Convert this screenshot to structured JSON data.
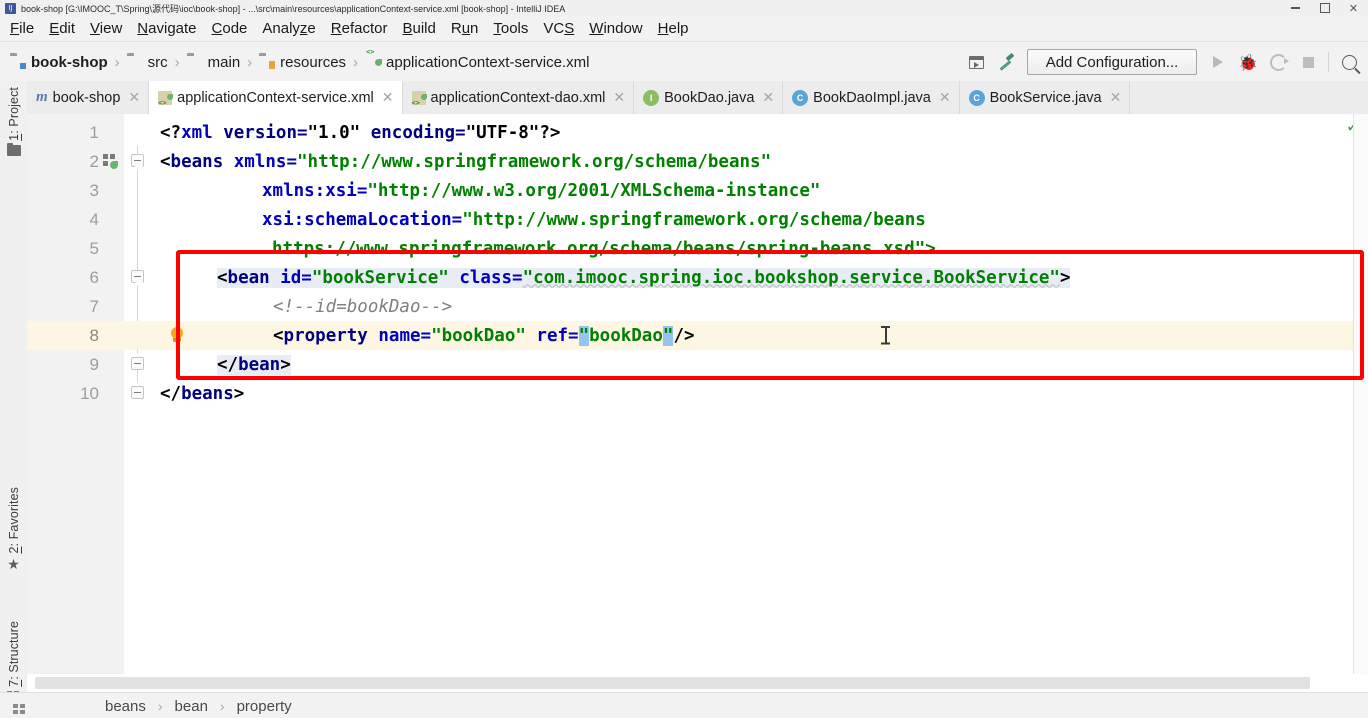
{
  "window": {
    "title": "book-shop [G:\\IMOOC_T\\Spring\\源代码\\ioc\\book-shop] - ...\\src\\main\\resources\\applicationContext-service.xml [book-shop] - IntelliJ IDEA",
    "app_icon": "intellij-idea-icon",
    "controls": {
      "minimize": "minimize-icon",
      "maximize": "restore-icon",
      "close": "close-icon"
    }
  },
  "menubar": {
    "items": [
      {
        "label": "File",
        "mnemonic": "F"
      },
      {
        "label": "Edit",
        "mnemonic": "E"
      },
      {
        "label": "View",
        "mnemonic": "V"
      },
      {
        "label": "Navigate",
        "mnemonic": "N"
      },
      {
        "label": "Code",
        "mnemonic": "C"
      },
      {
        "label": "Analyze",
        "mnemonic": "z"
      },
      {
        "label": "Refactor",
        "mnemonic": "R"
      },
      {
        "label": "Build",
        "mnemonic": "B"
      },
      {
        "label": "Run",
        "mnemonic": "u"
      },
      {
        "label": "Tools",
        "mnemonic": "T"
      },
      {
        "label": "VCS",
        "mnemonic": "S"
      },
      {
        "label": "Window",
        "mnemonic": "W"
      },
      {
        "label": "Help",
        "mnemonic": "H"
      }
    ]
  },
  "navbar": {
    "crumbs": [
      {
        "label": "book-shop",
        "icon": "module-icon"
      },
      {
        "label": "src",
        "icon": "folder-icon"
      },
      {
        "label": "main",
        "icon": "folder-icon"
      },
      {
        "label": "resources",
        "icon": "resources-folder-icon"
      },
      {
        "label": "applicationContext-service.xml",
        "icon": "spring-xml-file-icon"
      }
    ],
    "separator": "›"
  },
  "toolbar": {
    "run_config_icon": "run-configurations-icon",
    "build_icon": "build-hammer-icon",
    "add_configuration_label": "Add Configuration...",
    "run_icon": "run-icon",
    "debug_icon": "debug-icon",
    "coverage_icon": "run-with-coverage-icon",
    "stop_icon": "stop-icon",
    "search_icon": "search-everywhere-icon"
  },
  "tool_stripe": {
    "top": [
      {
        "label": "1: Project",
        "mnemonic": "1",
        "icon": "project-folder-icon"
      }
    ],
    "bottom": [
      {
        "label": "2: Favorites",
        "mnemonic": "2",
        "icon": "star-icon"
      },
      {
        "label": "7: Structure",
        "mnemonic": "7",
        "icon": "structure-icon"
      }
    ],
    "corner_icon": "layout-grid-icon"
  },
  "tabs": [
    {
      "label": "book-shop",
      "icon": "maven-module-icon",
      "active": false
    },
    {
      "label": "applicationContext-service.xml",
      "icon": "spring-xml-file-icon",
      "active": true
    },
    {
      "label": "applicationContext-dao.xml",
      "icon": "spring-xml-file-icon",
      "active": false
    },
    {
      "label": "BookDao.java",
      "icon": "interface-icon",
      "active": false
    },
    {
      "label": "BookDaoImpl.java",
      "icon": "class-icon",
      "active": false
    },
    {
      "label": "BookService.java",
      "icon": "class-icon",
      "active": false
    }
  ],
  "editor": {
    "current_line": 8,
    "inspection_status_icon": "no-errors-checkmark-icon",
    "intention_bulb_icon": "intention-bulb-icon",
    "spring_gutter_icon": "spring-bean-gutter-icon",
    "annotation_box_color": "#ff0000",
    "lines": [
      {
        "n": "1",
        "text": "<?xml version=\"1.0\" encoding=\"UTF-8\"?>"
      },
      {
        "n": "2",
        "text": "<beans xmlns=\"http://www.springframework.org/schema/beans\""
      },
      {
        "n": "3",
        "text": "       xmlns:xsi=\"http://www.w3.org/2001/XMLSchema-instance\""
      },
      {
        "n": "4",
        "text": "       xsi:schemaLocation=\"http://www.springframework.org/schema/beans"
      },
      {
        "n": "5",
        "text": "        https://www.springframework.org/schema/beans/spring-beans.xsd\">"
      },
      {
        "n": "6",
        "text": "  <bean id=\"bookService\" class=\"com.imooc.spring.ioc.bookshop.service.BookService\">"
      },
      {
        "n": "7",
        "text": "      <!--id=bookDao-->"
      },
      {
        "n": "8",
        "text": "      <property name=\"bookDao\" ref=\"bookDao\"/>"
      },
      {
        "n": "9",
        "text": "  </bean>"
      },
      {
        "n": "10",
        "text": "</beans>"
      }
    ],
    "tokens": {
      "l1": {
        "open": "<?",
        "tag": "xml",
        "a1": " version=",
        "v1": "\"1.0\"",
        "a2": " encoding=",
        "v2": "\"UTF-8\"",
        "close": "?>"
      },
      "l2": {
        "open": "<",
        "tag": "beans",
        "a1": " xmlns=",
        "v1": "\"http://www.springframework.org/schema/beans\""
      },
      "l3": {
        "attr": "xmlns:xsi=",
        "val": "\"http://www.w3.org/2001/XMLSchema-instance\""
      },
      "l4": {
        "attr": "xsi:schemaLocation=",
        "val": "\"http://www.springframework.org/schema/beans"
      },
      "l5": {
        "val": "https://www.springframework.org/schema/beans/spring-beans.xsd\">"
      },
      "l6": {
        "open": "<",
        "tag": "bean",
        "a1": " id=",
        "v1": "\"bookService\"",
        "a2": " class=",
        "v2": "\"com.imooc.spring.ioc.bookshop.service.BookService\"",
        "close": ">"
      },
      "l7": {
        "comment": "<!--id=bookDao-->"
      },
      "l8": {
        "open": "<",
        "tag": "property",
        "a1": " name=",
        "v1": "\"bookDao\"",
        "a2": " ref=",
        "q1": "\"",
        "v2": "bookDao",
        "q2": "\"",
        "close": "/>"
      },
      "l9": {
        "open": "</",
        "tag": "bean",
        "close": ">"
      },
      "l10": {
        "open": "</",
        "tag": "beans",
        "close": ">"
      }
    },
    "scrollbar": "horizontal-scrollbar"
  },
  "statusbar": {
    "grid_icon": "layout-grid-icon",
    "crumbs": [
      "beans",
      "bean",
      "property"
    ],
    "separator": "›"
  },
  "colors": {
    "tag": "#000080",
    "attribute": "#0000c0",
    "value": "#008000",
    "comment": "#808080",
    "annotation_box": "#ff0000",
    "current_line_bg": "#fdf6e3",
    "brace_match_bg": "#93c5f0"
  }
}
